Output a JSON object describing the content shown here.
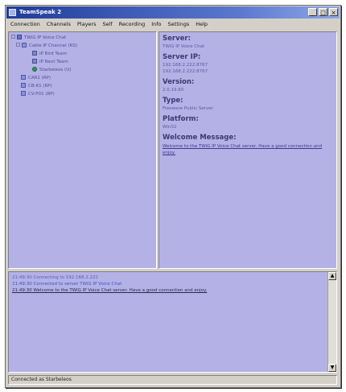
{
  "window": {
    "title": "TeamSpeak 2"
  },
  "title_buttons": [
    "_",
    "□",
    "×"
  ],
  "menu": [
    "Connection",
    "Channels",
    "Players",
    "Self",
    "Recording",
    "Info",
    "Settings",
    "Help"
  ],
  "tree": {
    "server": "TWiG IP Voice Chat",
    "channels": [
      {
        "name": "Cable IP Channel (RS)",
        "expanded": true,
        "players": [
          {
            "name": "IP Bird Team",
            "status": "normal"
          },
          {
            "name": "IP Next Team",
            "status": "normal"
          },
          {
            "name": "Starbeleos (U)",
            "status": "active"
          }
        ]
      },
      {
        "name": "CAR1 (RP)",
        "expanded": false,
        "players": []
      },
      {
        "name": "CB-61 (RP)",
        "expanded": false,
        "players": []
      },
      {
        "name": "CV-P01 (RP)",
        "expanded": false,
        "players": []
      }
    ]
  },
  "info": {
    "server_label": "Server:",
    "server_value": "TWiG IP Voice Chat",
    "ip_label": "Server IP:",
    "ip_values": [
      "192.168.2.222:8767",
      "192.168.2.222:8767"
    ],
    "version_label": "Version:",
    "version_value": "2.0.19.60",
    "type_label": "Type:",
    "type_value": "Freeware Public Server",
    "platform_label": "Platform:",
    "platform_value": "Win32",
    "welcome_label": "Welcome Message:",
    "welcome_value": "Welcome to the TWiG IP Voice Chat server. Have a good connection and enjoy."
  },
  "log": [
    {
      "ts": "21:49:30",
      "text": "Connecting to 192.168.2.222",
      "style": "normal"
    },
    {
      "ts": "21:49:30",
      "text": "Connected to server TWiG IP Voice Chat",
      "style": "blue"
    },
    {
      "ts": "21:49:30",
      "text": "Welcome to the TWiG IP Voice Chat server. Have a good connection and enjoy.",
      "style": "dark"
    }
  ],
  "scroll": {
    "up": "▲",
    "down": "▼"
  },
  "status": "Connected as Starbeleos",
  "colors": {
    "pane_bg": "#b3b1e6",
    "title_gradient_start": "#1f3b9a",
    "window_chrome": "#d4d0c8"
  }
}
